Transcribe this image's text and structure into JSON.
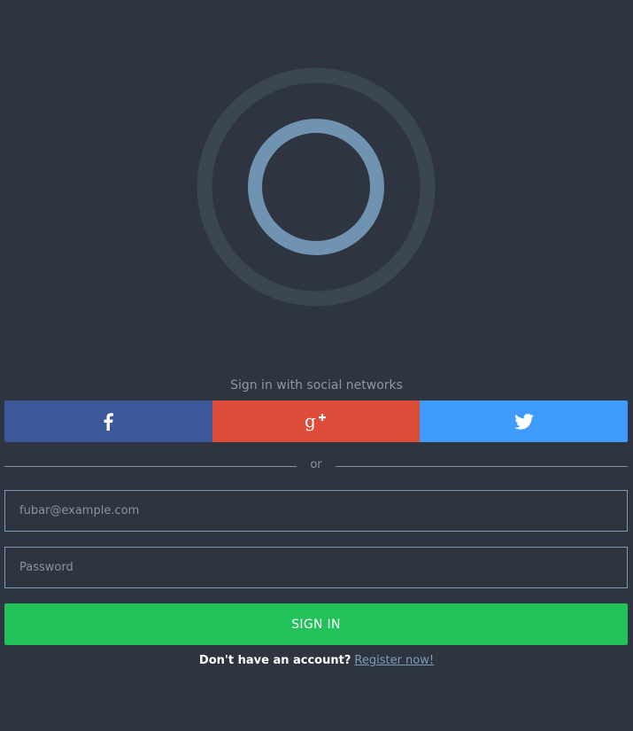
{
  "logo": {
    "outer_ring_color": "#3a4652",
    "inner_ring_color": "#6f93b0"
  },
  "social": {
    "caption": "Sign in with social networks",
    "buttons": [
      {
        "name": "facebook",
        "icon": "facebook-icon",
        "color": "#3b5998"
      },
      {
        "name": "google-plus",
        "icon": "google-plus-icon",
        "color": "#dd4b39"
      },
      {
        "name": "twitter",
        "icon": "twitter-icon",
        "color": "#3f9bfd"
      }
    ]
  },
  "divider": {
    "label": "or"
  },
  "form": {
    "email_placeholder": "fubar@example.com",
    "password_placeholder": "Password",
    "submit_label": "SIGN IN",
    "submit_color": "#21c25a"
  },
  "register": {
    "prompt": "Don't have an account?",
    "link_label": "Register now!"
  },
  "colors": {
    "background": "#2e3440",
    "field_border": "#7b9bb2",
    "link": "#7a9fbc"
  }
}
